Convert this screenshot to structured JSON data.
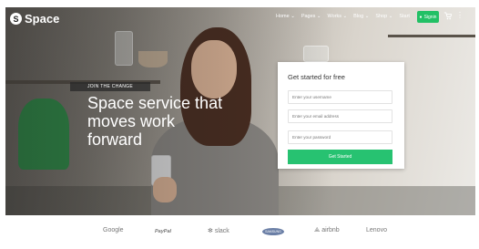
{
  "nav": {
    "logo_mark": "S",
    "logo_text": "Space",
    "items": [
      "Home ⌄",
      "Pages ⌄",
      "Works ⌄",
      "Blog ⌄",
      "Shop ⌄",
      "Start"
    ],
    "signin_label": "Signin",
    "more_icon": "⋮"
  },
  "hero": {
    "eyebrow": "JOIN THE CHANGE",
    "headline": "Space service that moves work forward"
  },
  "form": {
    "title": "Get started for free",
    "username_placeholder": "Enter your username",
    "email_placeholder": "Enter your email address",
    "password_placeholder": "Enter your password",
    "submit_label": "Get Started"
  },
  "brands": {
    "google": "Google",
    "paypal": "PayPal",
    "slack": "slack",
    "samsung": "SAMSUNG",
    "airbnb": "airbnb",
    "lenovo": "Lenovo"
  },
  "colors": {
    "accent": "#27c271"
  }
}
